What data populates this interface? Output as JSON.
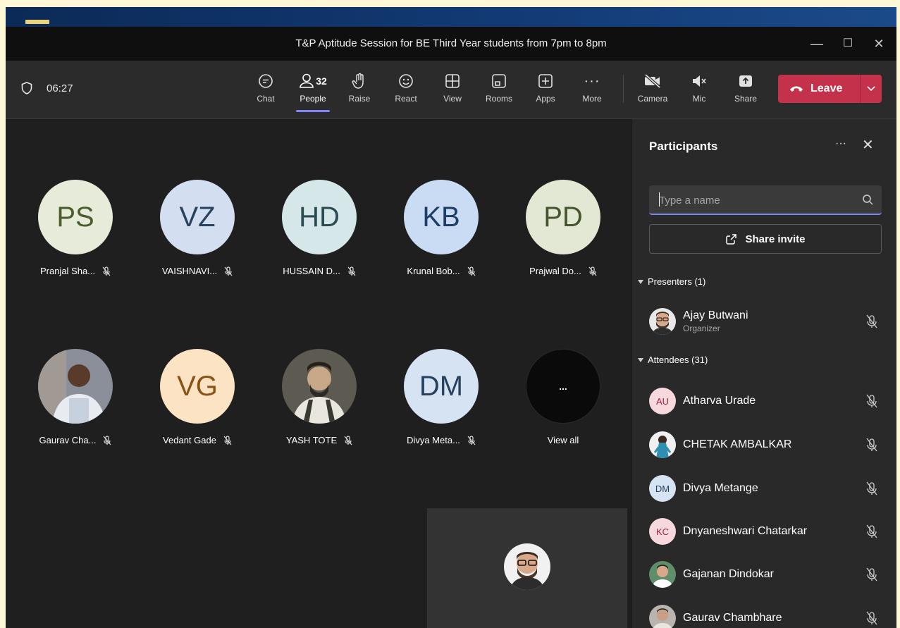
{
  "window": {
    "title": "T&P Aptitude Session for BE Third Year students from 7pm to 8pm",
    "minimize": "—",
    "maximize": "☐",
    "close": "✕"
  },
  "toolbar": {
    "timer": "06:27",
    "chat": "Chat",
    "people": "People",
    "people_count": "32",
    "raise": "Raise",
    "react": "React",
    "view": "View",
    "rooms": "Rooms",
    "apps": "Apps",
    "more": "More",
    "camera": "Camera",
    "mic": "Mic",
    "share": "Share",
    "leave": "Leave"
  },
  "stage": {
    "tiles": [
      {
        "initials": "PS",
        "name": "Pranjal Sha...",
        "bg": "#e7ebd9",
        "fg": "#4a5d2f"
      },
      {
        "initials": "VZ",
        "name": "VAISHNAVI...",
        "bg": "#d3dff0",
        "fg": "#27425f"
      },
      {
        "initials": "HD",
        "name": "HUSSAIN D...",
        "bg": "#d6e7ea",
        "fg": "#294b52"
      },
      {
        "initials": "KB",
        "name": "Krunal Bob...",
        "bg": "#c9dcf3",
        "fg": "#1e3d66"
      },
      {
        "initials": "PD",
        "name": "Prajwal Do...",
        "bg": "#e2e8d3",
        "fg": "#45552f"
      },
      {
        "initials": "",
        "name": "Gaurav Cha..."
      },
      {
        "initials": "VG",
        "name": "Vedant Gade",
        "bg": "#fbe3c4",
        "fg": "#8a5316"
      },
      {
        "initials": "",
        "name": "YASH TOTE"
      },
      {
        "initials": "DM",
        "name": "Divya Meta...",
        "bg": "#d6e3f2",
        "fg": "#27425f"
      },
      {
        "initials": "...",
        "name": "View all",
        "bg": "#0a0a0a",
        "fg": "#ffffff"
      }
    ]
  },
  "panel": {
    "title": "Participants",
    "more": "···",
    "close": "✕",
    "search_placeholder": "Type a name",
    "share_invite": "Share invite",
    "presenters_label": "Presenters (1)",
    "attendees_label": "Attendees (31)",
    "presenters": [
      {
        "name": "Ajay Butwani",
        "role": "Organizer"
      }
    ],
    "attendees": [
      {
        "initials": "AU",
        "name": "Atharva Urade",
        "bg": "#f7d8dd",
        "fg": "#a1243d"
      },
      {
        "initials": "",
        "name": "CHETAK AMBALKAR"
      },
      {
        "initials": "DM",
        "name": "Divya Metange",
        "bg": "#d6e3f2",
        "fg": "#27425f"
      },
      {
        "initials": "KC",
        "name": "Dnyaneshwari Chatarkar",
        "bg": "#f7d8dd",
        "fg": "#a1243d"
      },
      {
        "initials": "",
        "name": "Gajanan Dindokar"
      },
      {
        "initials": "",
        "name": "Gaurav Chambhare"
      }
    ]
  }
}
